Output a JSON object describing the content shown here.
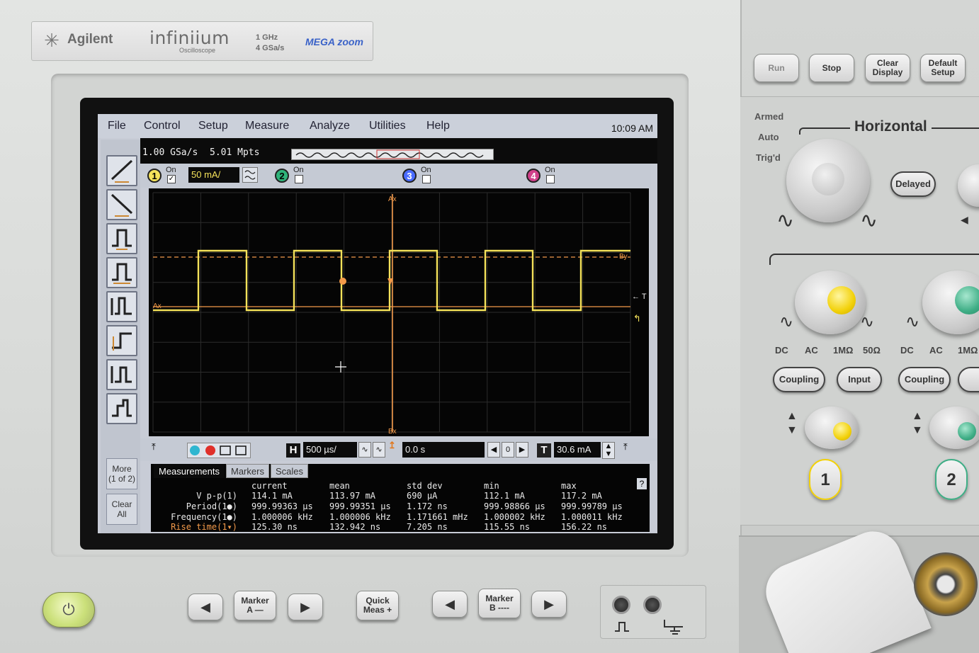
{
  "brand": {
    "company": "Agilent",
    "product": "infiniium",
    "subtitle": "Oscilloscope",
    "spec_line1": "1   GHz",
    "spec_line2": "4   GSa/s",
    "megazoom": "MEGA zoom"
  },
  "menu": {
    "items": [
      "File",
      "Control",
      "Setup",
      "Measure",
      "Analyze",
      "Utilities",
      "Help"
    ],
    "clock": "10:09 AM"
  },
  "acquisition": {
    "sample_rate": "1.00 GSa/s",
    "memory_depth": "5.01 Mpts"
  },
  "channels": [
    {
      "number": "1",
      "on_label": "On",
      "enabled": true,
      "scale": "50 mA/",
      "color": "#f4e25a"
    },
    {
      "number": "2",
      "on_label": "On",
      "enabled": false,
      "color": "#2fb37a"
    },
    {
      "number": "3",
      "on_label": "On",
      "enabled": false,
      "color": "#4a6cff"
    },
    {
      "number": "4",
      "on_label": "On",
      "enabled": false,
      "color": "#d0408a"
    }
  ],
  "waveform": {
    "shape": "square",
    "high_label": "By",
    "low_label": "Ax",
    "top_marker": "Ax",
    "bottom_marker": "Bx",
    "trigger_label": "T",
    "trace_color": "#f4e25a",
    "marker_color": "#f39a4a"
  },
  "toolbar": {
    "more_label": "More\n(1 of 2)",
    "clear_label": "Clear\nAll"
  },
  "controls": {
    "h_label": "H",
    "timebase": "500 µs/",
    "delay": "0.0 s",
    "zoom_digit": "0",
    "t_label": "T",
    "trigger_level": "30.6 mA"
  },
  "measurements": {
    "tabs": [
      "Measurements",
      "Markers",
      "Scales"
    ],
    "active_tab": "Measurements",
    "headers": [
      "current",
      "mean",
      "std dev",
      "min",
      "max"
    ],
    "rows": [
      {
        "name": "V p-p(1)",
        "current": "114.1 mA",
        "mean": "113.97 mA",
        "std_dev": "690 µA",
        "min": "112.1 mA",
        "max": "117.2 mA"
      },
      {
        "name": "Period(1●)",
        "current": "999.99363 µs",
        "mean": "999.99351 µs",
        "std_dev": "1.172 ns",
        "min": "999.98866 µs",
        "max": "999.99789 µs"
      },
      {
        "name": "Frequency(1●)",
        "current": "1.000006 kHz",
        "mean": "1.000006 kHz",
        "std_dev": "1.171661 mHz",
        "min": "1.000002 kHz",
        "max": "1.000011 kHz"
      },
      {
        "name": "Rise time(1▾)",
        "current": "125.30 ns",
        "mean": "132.942 ns",
        "std_dev": "7.205 ns",
        "min": "115.55 ns",
        "max": "156.22 ns"
      }
    ],
    "help_label": "?"
  },
  "front_panel": {
    "run": "Run",
    "stop": "Stop",
    "clear_display": "Clear\nDisplay",
    "default_setup": "Default\nSetup",
    "armed": "Armed",
    "auto": "Auto",
    "trigd": "Trig'd",
    "horizontal": "Horizontal",
    "delayed": "Delayed",
    "coupling_labels": [
      "DC",
      "AC",
      "1MΩ",
      "50Ω"
    ],
    "coupling_labels_ch2": [
      "DC",
      "AC",
      "1MΩ"
    ],
    "coupling": "Coupling",
    "input": "Input",
    "ch1_key": "1",
    "ch2_key": "2",
    "marker_a": "Marker\nA —",
    "marker_b": "Marker\nB ----",
    "quick_meas": "Quick\nMeas +"
  }
}
